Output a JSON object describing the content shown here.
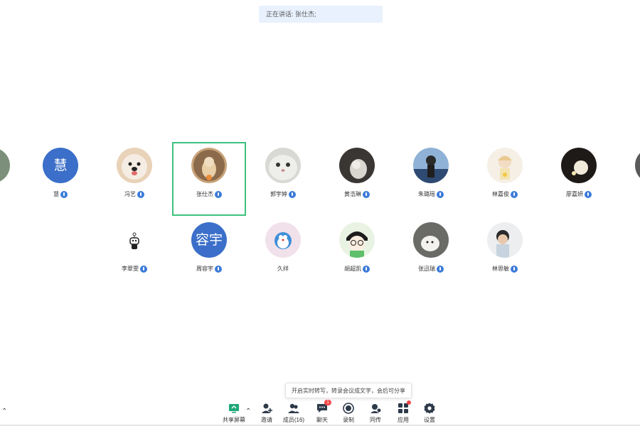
{
  "speaking": {
    "text": "正在讲话: 张仕杰;"
  },
  "participants": [
    {
      "name": "慧",
      "avatar_text": "慧"
    },
    {
      "name": "冯艺",
      "avatar": "dog-avatar"
    },
    {
      "name": "张仕杰",
      "avatar": "cat-pillow-avatar",
      "active": true
    },
    {
      "name": "郭宇婷",
      "avatar": "cat-face-avatar"
    },
    {
      "name": "黄浩琳",
      "avatar": "dark-cat-avatar"
    },
    {
      "name": "朱璐瑶",
      "avatar": "girl-avatar"
    },
    {
      "name": "林嘉俊",
      "avatar": "anime-avatar"
    },
    {
      "name": "廖嘉妍",
      "avatar": "light-figure-avatar"
    },
    {
      "name": "李翠雯",
      "avatar": "robot-avatar"
    },
    {
      "name": "周容宇",
      "avatar_text": "容宇"
    },
    {
      "name": "久绊",
      "avatar": "doraemon-avatar"
    },
    {
      "name": "胡超凯",
      "avatar": "glasses-boy-avatar"
    },
    {
      "name": "张迅瑞",
      "avatar": "puppy-avatar"
    },
    {
      "name": "林思敏",
      "avatar": "child-avatar"
    }
  ],
  "tooltip": {
    "text": "开启实时转写，转录会议成文字，会后可分享"
  },
  "toolbar": {
    "share": "共享屏幕",
    "invite": "邀请",
    "members": "成员(16)",
    "chat": "聊天",
    "chat_badge": "1",
    "record": "录制",
    "interpret": "同传",
    "apps": "应用",
    "settings": "设置"
  },
  "colors": {
    "accent": "#3b6fc9",
    "active_border": "#3ec17e",
    "badge": "#f24a4a"
  }
}
